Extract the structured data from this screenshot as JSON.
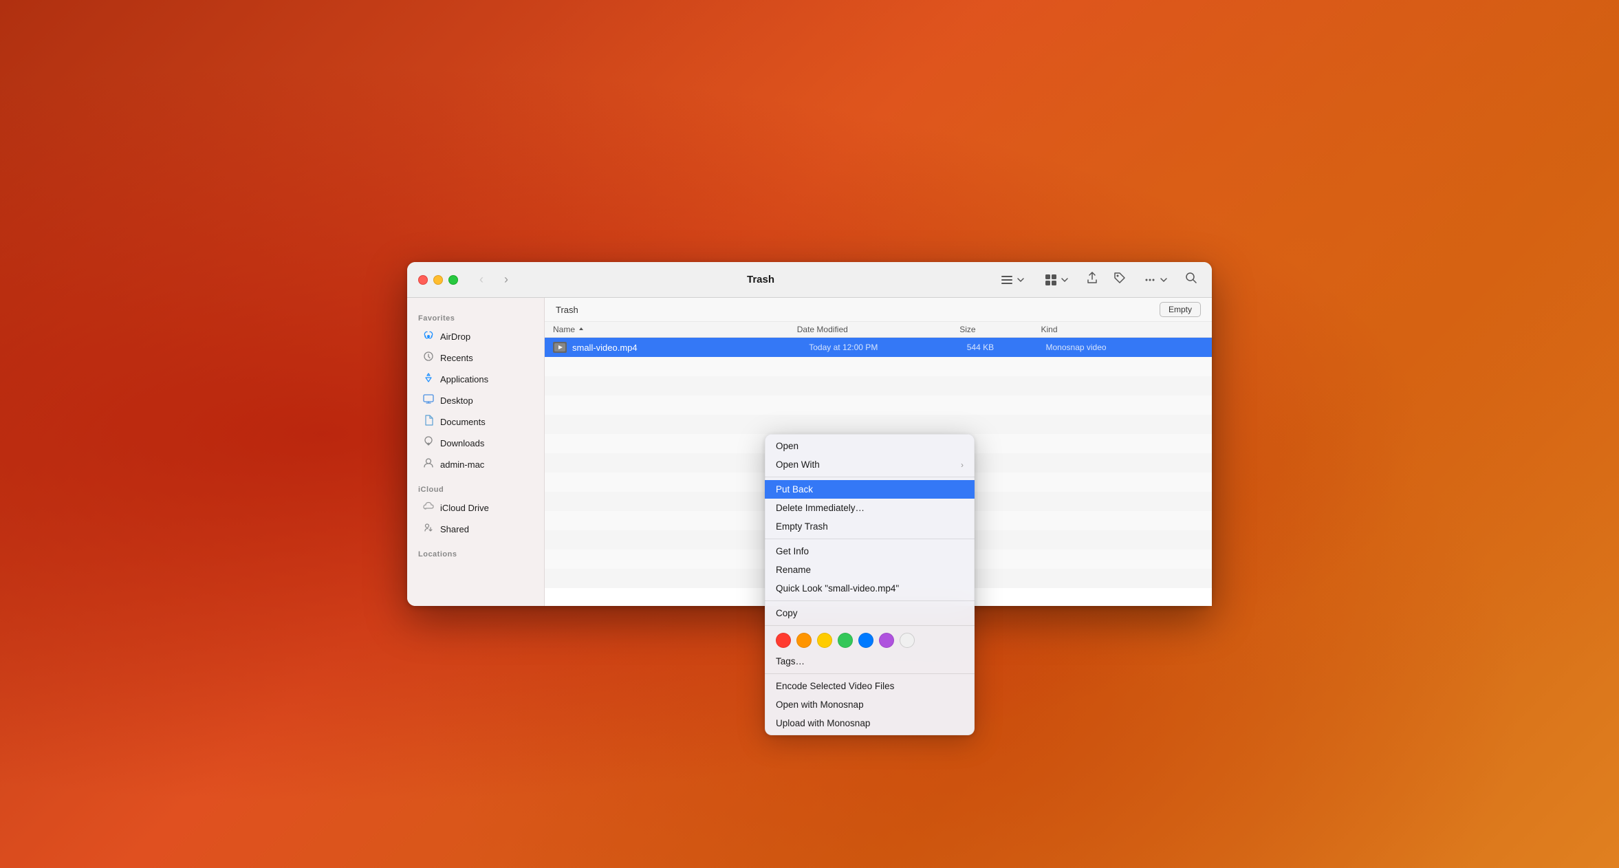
{
  "desktop": {
    "bg_description": "macOS Ventura orange wallpaper"
  },
  "window": {
    "title": "Trash",
    "breadcrumb": "Trash",
    "empty_button": "Empty",
    "nav": {
      "back": "‹",
      "forward": "›"
    },
    "toolbar": {
      "view_list": "≡",
      "view_grid": "⊞",
      "share": "↑",
      "tag": "🏷",
      "more": "···",
      "search": "⌕"
    }
  },
  "sidebar": {
    "favorites_label": "Favorites",
    "icloud_label": "iCloud",
    "locations_label": "Locations",
    "items": [
      {
        "id": "airdrop",
        "label": "AirDrop",
        "icon": "wifi"
      },
      {
        "id": "recents",
        "label": "Recents",
        "icon": "clock"
      },
      {
        "id": "applications",
        "label": "Applications",
        "icon": "grid"
      },
      {
        "id": "desktop",
        "label": "Desktop",
        "icon": "monitor"
      },
      {
        "id": "documents",
        "label": "Documents",
        "icon": "doc"
      },
      {
        "id": "downloads",
        "label": "Downloads",
        "icon": "arrow-down"
      },
      {
        "id": "admin",
        "label": "admin-mac",
        "icon": "house"
      }
    ],
    "icloud_items": [
      {
        "id": "icloud-drive",
        "label": "iCloud Drive",
        "icon": "cloud"
      },
      {
        "id": "shared",
        "label": "Shared",
        "icon": "folder-shared"
      }
    ]
  },
  "file_list": {
    "columns": {
      "name": "Name",
      "date_modified": "Date Modified",
      "size": "Size",
      "kind": "Kind"
    },
    "files": [
      {
        "name": "small-video.mp4",
        "date_modified": "Today at 12:00 PM",
        "size": "544 KB",
        "kind": "Monosnap video",
        "selected": true
      }
    ]
  },
  "context_menu": {
    "items": [
      {
        "id": "open",
        "label": "Open",
        "has_arrow": false,
        "highlighted": false,
        "separator_after": false
      },
      {
        "id": "open-with",
        "label": "Open With",
        "has_arrow": true,
        "highlighted": false,
        "separator_after": true
      },
      {
        "id": "put-back",
        "label": "Put Back",
        "has_arrow": false,
        "highlighted": true,
        "separator_after": false
      },
      {
        "id": "delete-immediately",
        "label": "Delete Immediately…",
        "has_arrow": false,
        "highlighted": false,
        "separator_after": false
      },
      {
        "id": "empty-trash",
        "label": "Empty Trash",
        "has_arrow": false,
        "highlighted": false,
        "separator_after": true
      },
      {
        "id": "get-info",
        "label": "Get Info",
        "has_arrow": false,
        "highlighted": false,
        "separator_after": false
      },
      {
        "id": "rename",
        "label": "Rename",
        "has_arrow": false,
        "highlighted": false,
        "separator_after": false
      },
      {
        "id": "quick-look",
        "label": "Quick Look \"small-video.mp4\"",
        "has_arrow": false,
        "highlighted": false,
        "separator_after": true
      },
      {
        "id": "copy",
        "label": "Copy",
        "has_arrow": false,
        "highlighted": false,
        "separator_after": true
      },
      {
        "id": "tags",
        "label": "Tags…",
        "has_arrow": false,
        "highlighted": false,
        "separator_after": true
      },
      {
        "id": "encode",
        "label": "Encode Selected Video Files",
        "has_arrow": false,
        "highlighted": false,
        "separator_after": false
      },
      {
        "id": "open-monosnap",
        "label": "Open with Monosnap",
        "has_arrow": false,
        "highlighted": false,
        "separator_after": false
      },
      {
        "id": "upload-monosnap",
        "label": "Upload with Monosnap",
        "has_arrow": false,
        "highlighted": false,
        "separator_after": false
      }
    ],
    "color_dots": [
      {
        "id": "red",
        "color": "#ff3b30"
      },
      {
        "id": "orange",
        "color": "#ff9500"
      },
      {
        "id": "yellow",
        "color": "#ffcc00"
      },
      {
        "id": "green",
        "color": "#34c759"
      },
      {
        "id": "blue",
        "color": "#007aff"
      },
      {
        "id": "purple",
        "color": "#af52de"
      },
      {
        "id": "none",
        "color": "#f0f0f0"
      }
    ]
  }
}
